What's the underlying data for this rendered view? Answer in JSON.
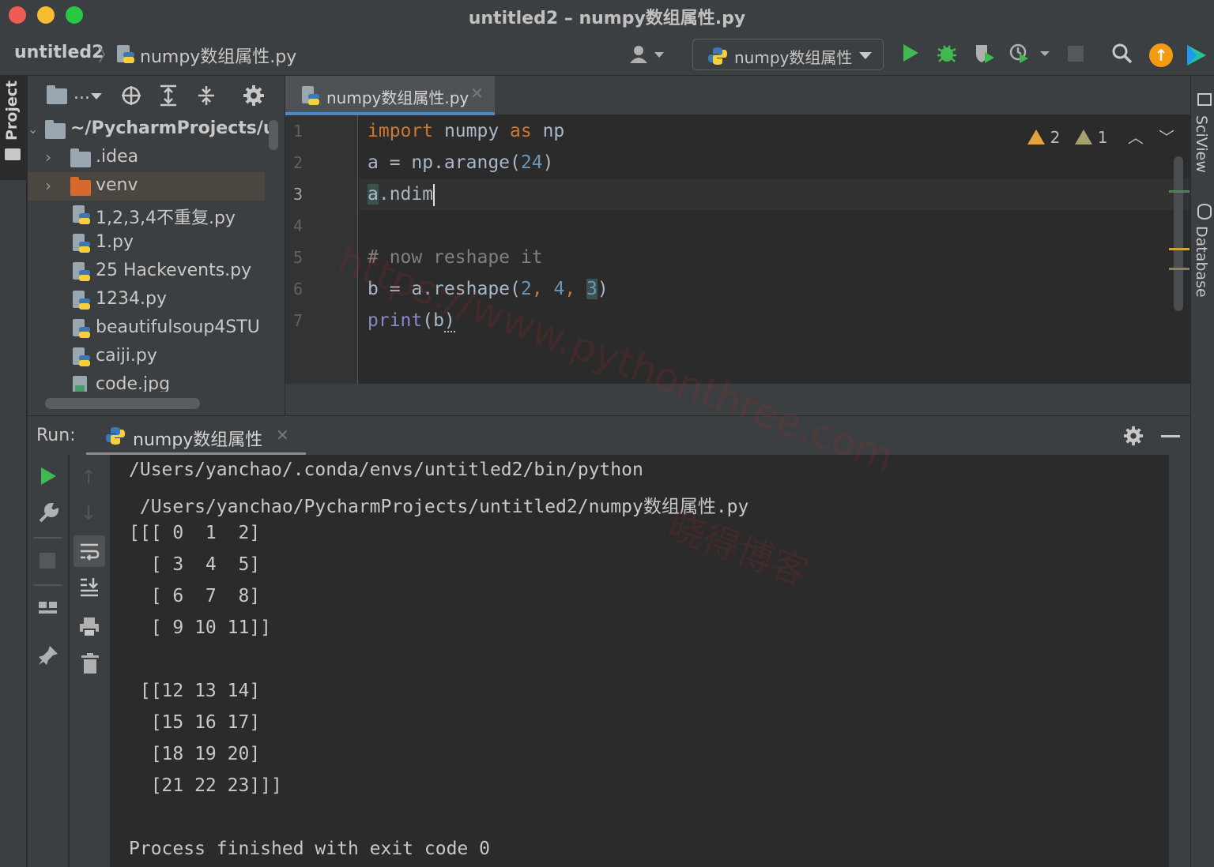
{
  "window": {
    "title": "untitled2 – numpy数组属性.py"
  },
  "navbar": {
    "project": "untitled2",
    "file": "numpy数组属性.py",
    "run_config": "numpy数组属性"
  },
  "left_strip": {
    "project_tab": "Project"
  },
  "project_panel": {
    "toolbar_dropdown": "...",
    "root": "~/PycharmProjects/u",
    "items": [
      {
        "label": ".idea",
        "type": "folder"
      },
      {
        "label": "venv",
        "type": "folder-excluded"
      },
      {
        "label": "1,2,3,4不重复.py",
        "type": "py"
      },
      {
        "label": "1.py",
        "type": "py"
      },
      {
        "label": "25 Hackevents.py",
        "type": "py"
      },
      {
        "label": "1234.py",
        "type": "py"
      },
      {
        "label": "beautifulsoup4STU",
        "type": "py"
      },
      {
        "label": "caiji.py",
        "type": "py"
      },
      {
        "label": "code.jpg",
        "type": "image"
      }
    ]
  },
  "editor": {
    "tab_label": "numpy数组属性.py",
    "line_numbers": [
      "1",
      "2",
      "3",
      "4",
      "5",
      "6",
      "7"
    ],
    "lines": {
      "l1_kw_import": "import",
      "l1_mod": " numpy ",
      "l1_kw_as": "as",
      "l1_alias": " np",
      "l2_a": "a = np.arange(",
      "l2_num": "24",
      "l2_end": ")",
      "l3_a": "a",
      "l3_rest": ".ndim",
      "l5_comment": "# now reshape it",
      "l6_start": "b = a.reshape(",
      "l6_n1": "2",
      "l6_c1": ", ",
      "l6_n2": "4",
      "l6_c2": ", ",
      "l6_n3": "3",
      "l6_end": ")",
      "l7_print": "print",
      "l7_open": "(",
      "l7_b": "b",
      "l7_close": ")"
    },
    "warnings": "2",
    "weak_warnings": "1"
  },
  "right_strip": {
    "sciview": "SciView",
    "database": "Database"
  },
  "run_panel": {
    "title": "Run:",
    "tab_label": "numpy数组属性",
    "console": [
      "/Users/yanchao/.conda/envs/untitled2/bin/python",
      " /Users/yanchao/PycharmProjects/untitled2/numpy数组属性.py",
      "[[[ 0  1  2]",
      "  [ 3  4  5]",
      "  [ 6  7  8]",
      "  [ 9 10 11]]",
      "",
      " [[12 13 14]",
      "  [15 16 17]",
      "  [18 19 20]",
      "  [21 22 23]]]",
      "",
      "Process finished with exit code 0"
    ]
  },
  "watermark": {
    "url": "https://www.pythonthree.com",
    "name": "晓得博客"
  },
  "colors": {
    "accent_blue": "#4a88c7",
    "run_green": "#3fb950",
    "keyword": "#cc7832",
    "number": "#6897bb",
    "comment": "#808080",
    "builtin": "#8888c6"
  }
}
